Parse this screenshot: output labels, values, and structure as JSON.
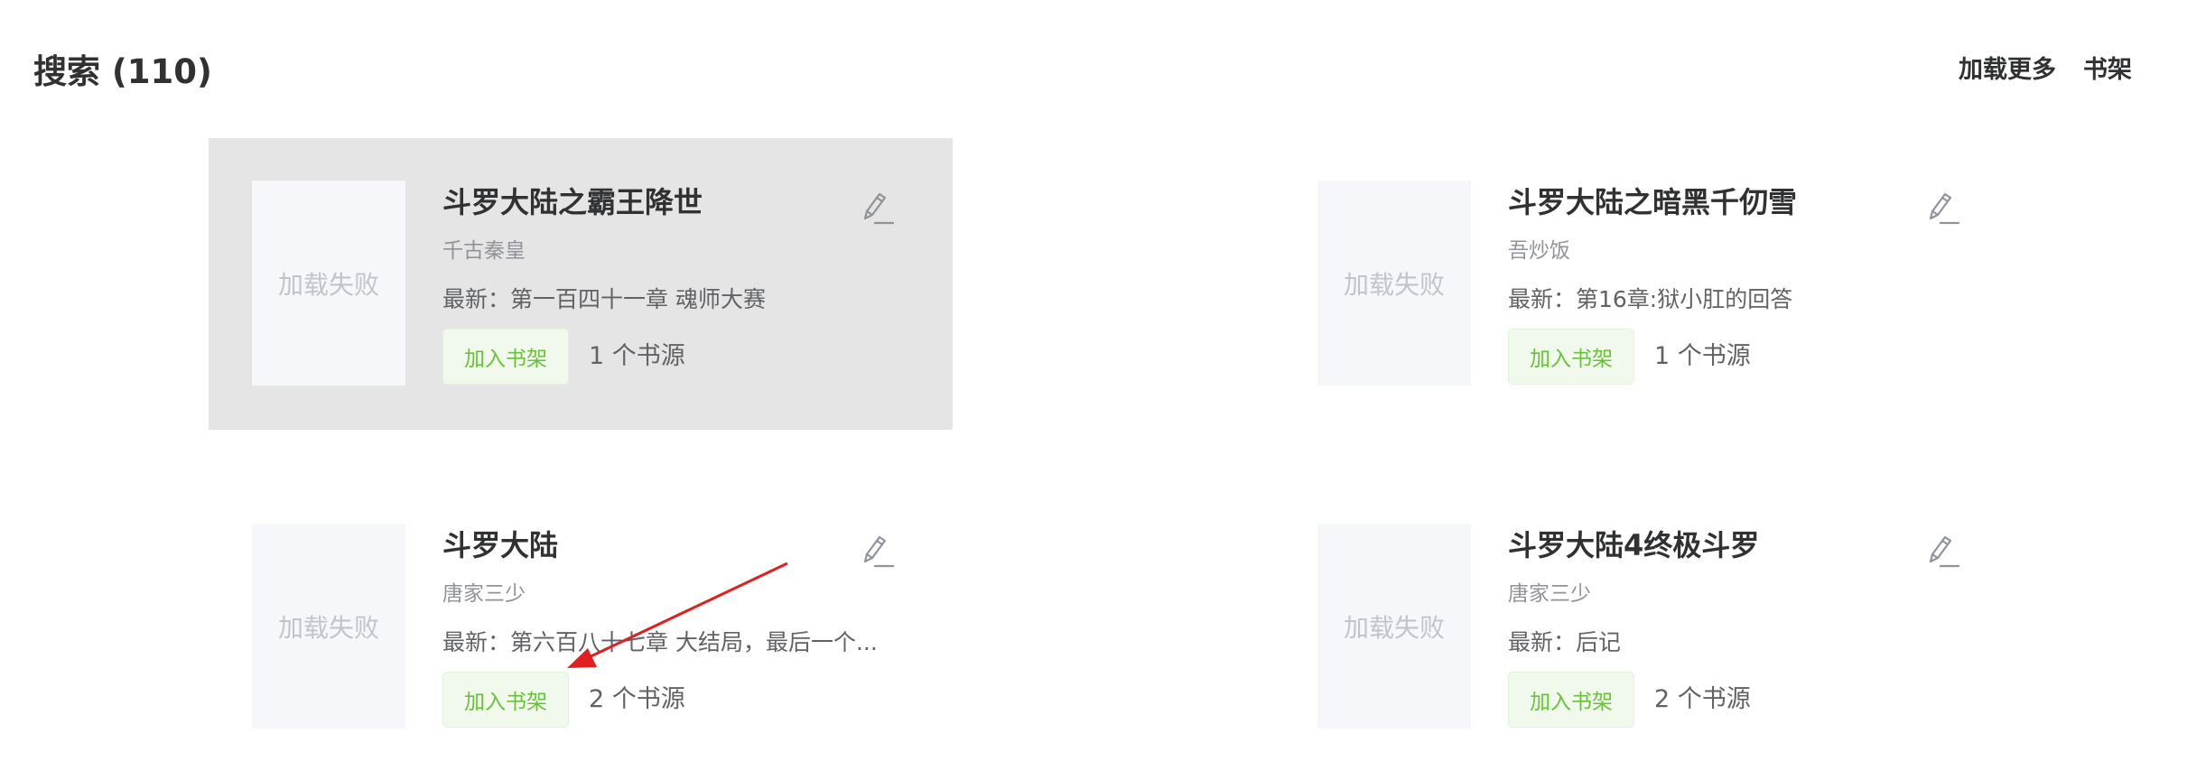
{
  "header": {
    "title": "搜索 (110)",
    "actions": [
      "加载更多",
      "书架"
    ]
  },
  "books": [
    {
      "title": "斗罗大陆之霸王降世",
      "author": "千古秦皇",
      "latest": "最新：第一百四十一章 魂师大赛",
      "cover_text": "加载失败",
      "add_label": "加入书架",
      "sources": "1 个书源",
      "hovered": true
    },
    {
      "title": "斗罗大陆之暗黑千仞雪",
      "author": "吾炒饭",
      "latest": "最新：第16章:狱小肛的回答",
      "cover_text": "加载失败",
      "add_label": "加入书架",
      "sources": "1 个书源",
      "hovered": false
    },
    {
      "title": "斗罗大陆",
      "author": "唐家三少",
      "latest": "最新：第六百八十七章 大结局，最后一个...",
      "cover_text": "加载失败",
      "add_label": "加入书架",
      "sources": "2 个书源",
      "hovered": false
    },
    {
      "title": "斗罗大陆4终极斗罗",
      "author": "唐家三少",
      "latest": "最新：后记",
      "cover_text": "加载失败",
      "add_label": "加入书架",
      "sources": "2 个书源",
      "hovered": false
    }
  ],
  "colors": {
    "accent_green": "#67c23a",
    "hover_bg": "#e5e5e5",
    "annotation_arrow": "#e02020"
  },
  "icons": {
    "edit": "pencil-icon"
  }
}
